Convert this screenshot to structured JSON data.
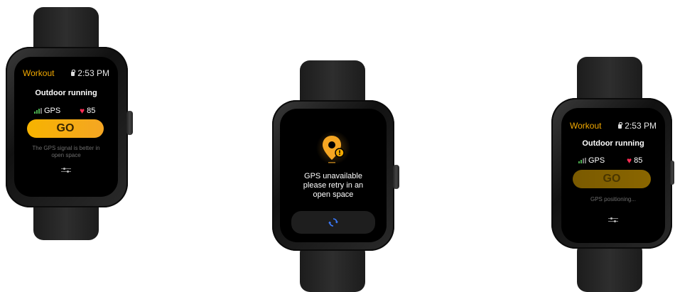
{
  "watch1": {
    "workout_label": "Workout",
    "time": "2:53 PM",
    "title": "Outdoor running",
    "gps_label": "GPS",
    "heart_rate": "85",
    "go_label": "GO",
    "hint_line1": "The GPS signal is better in",
    "hint_line2": "open space"
  },
  "watch2": {
    "message_line1": "GPS unavailable",
    "message_line2": "please retry in an",
    "message_line3": "open space"
  },
  "watch3": {
    "workout_label": "Workout",
    "time": "2:53 PM",
    "title": "Outdoor running",
    "gps_label": "GPS",
    "heart_rate": "85",
    "go_label": "GO",
    "hint_line1": "GPS positioning..."
  },
  "colors": {
    "accent": "#f2a900",
    "heart": "#ff2d55",
    "signal": "#4caf50",
    "retry": "#3b7bff"
  }
}
